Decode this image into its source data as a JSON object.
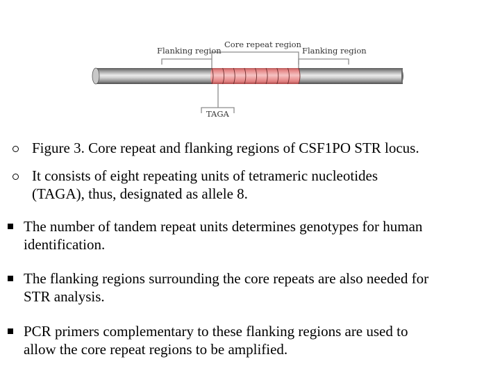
{
  "figure": {
    "labels": {
      "flanking_left": "Flanking region",
      "core": "Core repeat region",
      "flanking_right": "Flanking region",
      "unit": "TAGA"
    },
    "repeat_count": 8,
    "colors": {
      "tube_gray": "#9a9a9a",
      "repeat_pink": "#e88a8a",
      "bracket": "#8c8c8c"
    }
  },
  "sub_bullets": [
    {
      "text": "Figure 3. Core repeat and flanking regions of CSF1PO STR locus."
    },
    {
      "text": "It  consists of eight repeating units of tetrameric nucleotides\n(TAGA), thus, designated as allele 8."
    }
  ],
  "bullets": [
    {
      "text": "The number of tandem repeat units determines genotypes for human\nidentification."
    },
    {
      "text": "The flanking regions surrounding the core repeats are also needed for\nSTR analysis."
    },
    {
      "text": "PCR primers complementary to these flanking regions are used to\nallow the core repeat regions to be amplified."
    }
  ]
}
